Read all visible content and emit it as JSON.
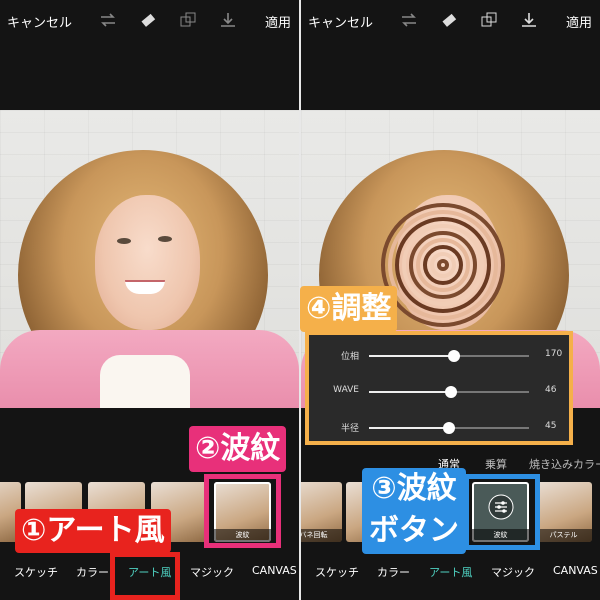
{
  "left": {
    "topbar": {
      "cancel": "キャンセル",
      "apply": "適用"
    },
    "thumbs": [
      "",
      "",
      "",
      "",
      "波紋"
    ],
    "categories": [
      "スケッチ",
      "カラー",
      "アート風",
      "マジック",
      "CANVAS"
    ],
    "active_category": "アート風"
  },
  "right": {
    "topbar": {
      "cancel": "キャンセル",
      "apply": "適用"
    },
    "thumbs": [
      "",
      "",
      "",
      "",
      "波紋",
      "パステル"
    ],
    "thumb_extra": "バネ回転",
    "blend_modes": [
      "通常",
      "乗算",
      "焼き込みカラー"
    ],
    "sliders": [
      {
        "name": "位相",
        "value": 170,
        "fraction": 0.53
      },
      {
        "name": "WAVE",
        "value": 46,
        "fraction": 0.51
      },
      {
        "name": "半径",
        "value": 45,
        "fraction": 0.5
      }
    ],
    "categories": [
      "スケッチ",
      "カラー",
      "アート風",
      "マジック",
      "CANVAS"
    ],
    "active_category": "アート風"
  },
  "callouts": {
    "c1": "①アート風",
    "c2": "②波紋",
    "c3a": "③波紋",
    "c3b": "ボタン",
    "c4": "④調整"
  },
  "colors": {
    "red": "#e8231e",
    "pink": "#e8307a",
    "blue": "#2d8fe3",
    "orange": "#f5b04a",
    "teal_active": "#4fd2c2"
  }
}
